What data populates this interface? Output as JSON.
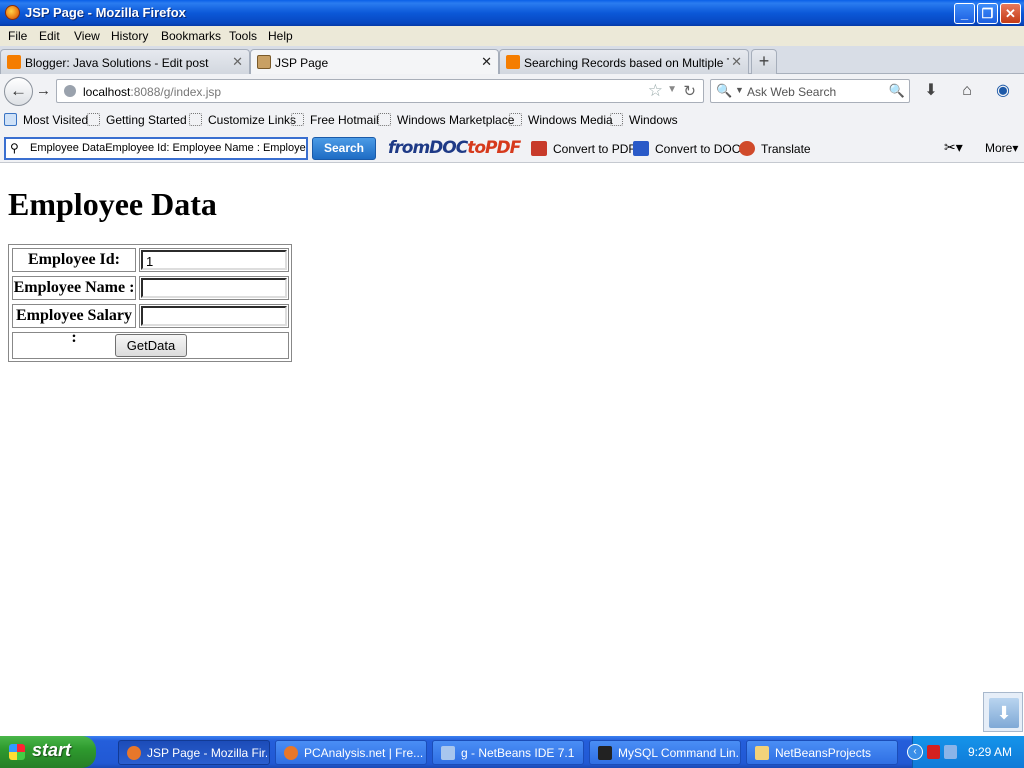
{
  "window": {
    "title": "JSP Page - Mozilla Firefox",
    "minimize": "_",
    "maximize": "❐",
    "close": "✕"
  },
  "menu": [
    "File",
    "Edit",
    "View",
    "History",
    "Bookmarks",
    "Tools",
    "Help"
  ],
  "tabs": [
    {
      "label": "Blogger: Java Solutions - Edit post",
      "icon": "blogger-icon",
      "color": "#f57d00"
    },
    {
      "label": "JSP Page",
      "icon": "page-icon",
      "color": "#c8a064"
    },
    {
      "label": "Searching Records based on Multiple Tex...",
      "icon": "blogger-icon",
      "color": "#f57d00"
    }
  ],
  "tab_close": "✕",
  "new_tab": "+",
  "nav": {
    "url_host": "localhost",
    "url_rest": ":8088/g/index.jsp",
    "search_placeholder": "Ask Web Search"
  },
  "bookmarks": [
    "Most Visited",
    "Getting Started",
    "Customize Links",
    "Free Hotmail",
    "Windows Marketplace",
    "Windows Media",
    "Windows"
  ],
  "toolbar": {
    "search_value": "Employee DataEmployee Id:   Employee Name :   Employee Salary :",
    "search_button": "Search",
    "logo_a": "fromDOC",
    "logo_b": "toPDF",
    "convert_pdf": "Convert to PDF",
    "convert_doc": "Convert to DOC",
    "translate": "Translate",
    "more": "More"
  },
  "page": {
    "heading": "Employee Data",
    "employee_id_label": "Employee Id:",
    "employee_id_value": "1",
    "employee_name_label": "Employee Name :",
    "employee_name_value": "",
    "employee_salary_label": "Employee Salary :",
    "employee_salary_value": "",
    "button": "GetData"
  },
  "taskbar": {
    "start": "start",
    "tasks": [
      {
        "label": "JSP Page - Mozilla Fir...",
        "active": true
      },
      {
        "label": "PCAnalysis.net | Fre...",
        "active": false
      },
      {
        "label": "g - NetBeans IDE 7.1",
        "active": false
      },
      {
        "label": "MySQL Command Lin...",
        "active": false
      },
      {
        "label": "NetBeansProjects",
        "active": false
      }
    ],
    "clock": "9:29 AM"
  }
}
